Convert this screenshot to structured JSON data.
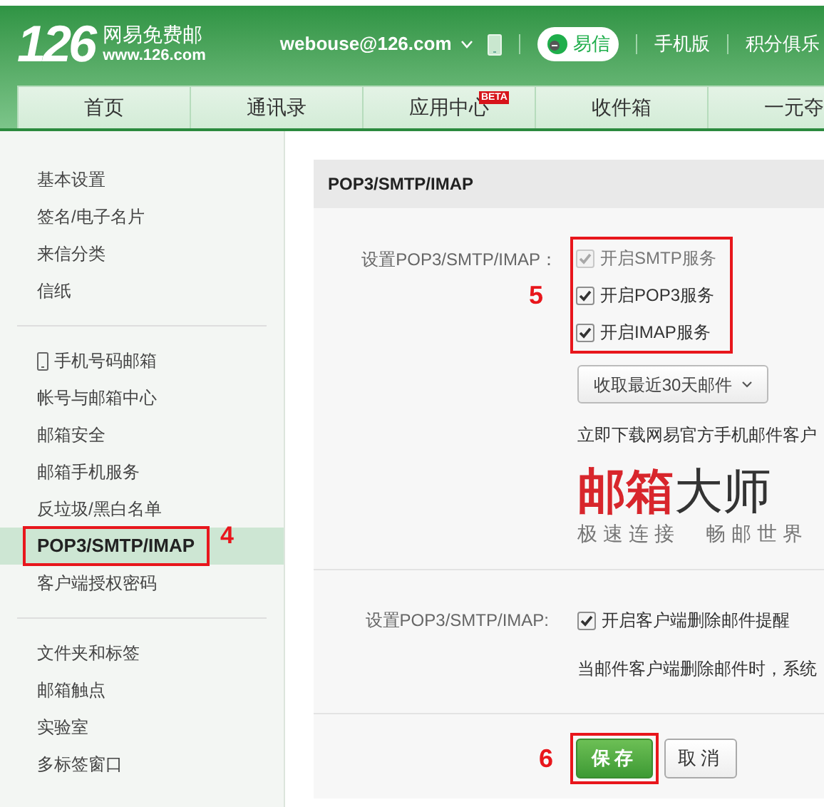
{
  "header": {
    "logo": "126",
    "brand": "网易免费邮",
    "domain": "www.126.com",
    "account": "webouse@126.com",
    "yixin": "易信",
    "links": [
      "手机版",
      "积分俱乐"
    ]
  },
  "nav_tabs": [
    {
      "label": "首页"
    },
    {
      "label": "通讯录"
    },
    {
      "label": "应用中心",
      "badge": "BETA"
    },
    {
      "label": "收件箱"
    },
    {
      "label": "一元夺"
    }
  ],
  "sidebar": {
    "groups": [
      [
        {
          "label": "基本设置",
          "selected": false
        },
        {
          "label": "签名/电子名片",
          "selected": false
        },
        {
          "label": "来信分类",
          "selected": false
        },
        {
          "label": "信纸",
          "selected": false
        }
      ],
      [
        {
          "label": "手机号码邮箱",
          "selected": false,
          "kind": "phone"
        },
        {
          "label": "帐号与邮箱中心",
          "selected": false
        },
        {
          "label": "邮箱安全",
          "selected": false
        },
        {
          "label": "邮箱手机服务",
          "selected": false
        },
        {
          "label": "反垃圾/黑白名单",
          "selected": false
        },
        {
          "label": "POP3/SMTP/IMAP",
          "selected": true,
          "annotation": "4"
        },
        {
          "label": "客户端授权密码",
          "selected": false
        }
      ],
      [
        {
          "label": "文件夹和标签",
          "selected": false
        },
        {
          "label": "邮箱触点",
          "selected": false
        },
        {
          "label": "实验室",
          "selected": false
        },
        {
          "label": "多标签窗口",
          "selected": false
        }
      ]
    ]
  },
  "panel": {
    "title": "POP3/SMTP/IMAP",
    "service_section": {
      "label": "设置POP3/SMTP/IMAP：",
      "annotation": "5",
      "options": [
        {
          "label": "开启SMTP服务",
          "checked": true,
          "disabled": true
        },
        {
          "label": "开启POP3服务",
          "checked": true,
          "disabled": false
        },
        {
          "label": "开启IMAP服务",
          "checked": true,
          "disabled": false
        }
      ],
      "dropdown": "收取最近30天邮件",
      "download_text": "立即下载网易官方手机邮件客户",
      "promo_title_red": "邮箱",
      "promo_title_dark": "大师",
      "promo_tagline": "极速连接　畅邮世界"
    },
    "delete_section": {
      "label": "设置POP3/SMTP/IMAP:",
      "option": {
        "label": "开启客户端删除邮件提醒",
        "checked": true
      },
      "note": "当邮件客户端删除邮件时，系统"
    },
    "buttons": [
      {
        "label": "保存",
        "kind": "primary",
        "annotation": "6"
      },
      {
        "label": "取消",
        "kind": "secondary"
      }
    ]
  }
}
